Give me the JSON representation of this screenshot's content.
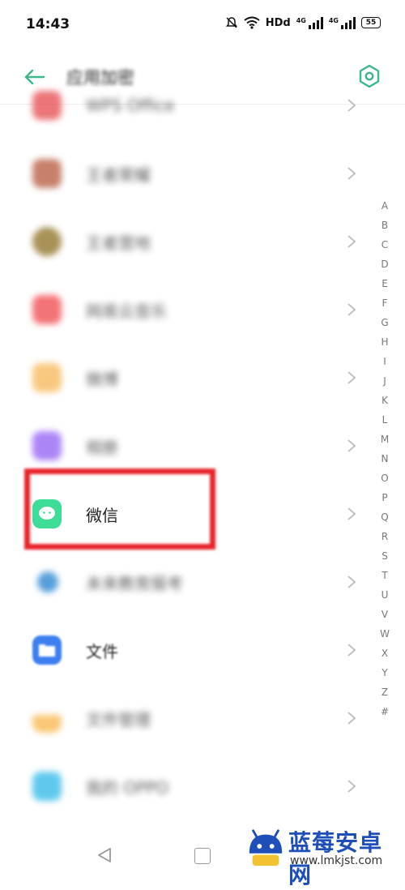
{
  "status": {
    "time": "14:43",
    "network_hd": "HDd",
    "signal1": "4G",
    "signal2": "4G",
    "battery": "55"
  },
  "header": {
    "title": "应用加密"
  },
  "apps": [
    {
      "label": "WPS Office",
      "color": "#e5484d"
    },
    {
      "label": "王者荣耀",
      "color": "#b4563a"
    },
    {
      "label": "王者营地",
      "color": "#8a6d1f"
    },
    {
      "label": "网易云音乐",
      "color": "#f0454a"
    },
    {
      "label": "微博",
      "color": "#f6b655"
    },
    {
      "label": "相册",
      "color": "#8f5cf3"
    },
    {
      "label": "微信",
      "color": "#3ddc97"
    },
    {
      "label": "未来教育报考",
      "color": "#1f7fcf"
    },
    {
      "label": "文件",
      "color": "#3d7ff0"
    },
    {
      "label": "文件管理",
      "color": "#f7b547"
    },
    {
      "label": "我的 OPPO",
      "color": "#2bb6e8"
    }
  ],
  "alphabet": [
    "A",
    "B",
    "C",
    "D",
    "E",
    "F",
    "G",
    "H",
    "I",
    "J",
    "K",
    "L",
    "M",
    "N",
    "O",
    "P",
    "Q",
    "R",
    "S",
    "T",
    "U",
    "V",
    "W",
    "X",
    "Y",
    "Z",
    "#"
  ],
  "colors": {
    "accent": "#3cb88a",
    "highlight": "#e6232a"
  },
  "watermark": {
    "name": "蓝莓安卓网",
    "url": "www.lmkjst.com"
  }
}
